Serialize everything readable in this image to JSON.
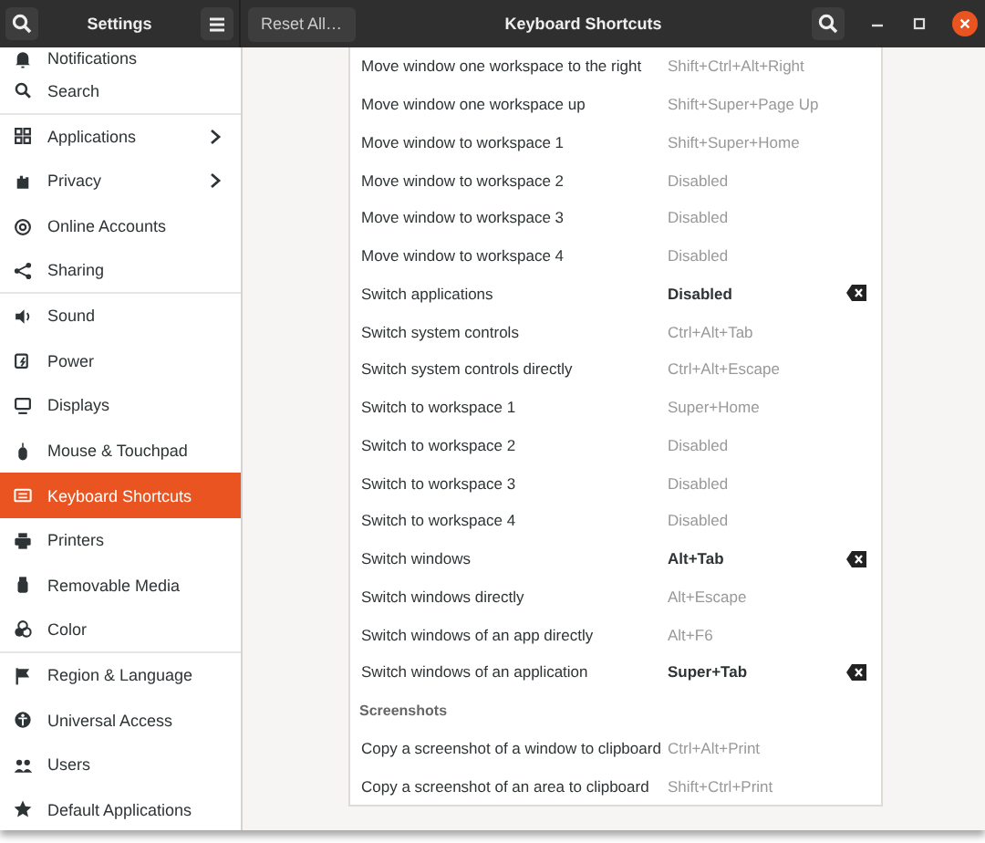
{
  "header": {
    "left_title": "Settings",
    "reset_button": "Reset All…",
    "title": "Keyboard Shortcuts"
  },
  "sidebar": {
    "items": [
      {
        "label": "Notifications",
        "selected": false,
        "arrow": false,
        "separator_after": false
      },
      {
        "label": "Search",
        "selected": false,
        "arrow": false,
        "separator_after": true
      },
      {
        "label": "Applications",
        "selected": false,
        "arrow": true,
        "separator_after": false
      },
      {
        "label": "Privacy",
        "selected": false,
        "arrow": true,
        "separator_after": false
      },
      {
        "label": "Online Accounts",
        "selected": false,
        "arrow": false,
        "separator_after": false
      },
      {
        "label": "Sharing",
        "selected": false,
        "arrow": false,
        "separator_after": true
      },
      {
        "label": "Sound",
        "selected": false,
        "arrow": false,
        "separator_after": false
      },
      {
        "label": "Power",
        "selected": false,
        "arrow": false,
        "separator_after": false
      },
      {
        "label": "Displays",
        "selected": false,
        "arrow": false,
        "separator_after": false
      },
      {
        "label": "Mouse & Touchpad",
        "selected": false,
        "arrow": false,
        "separator_after": false
      },
      {
        "label": "Keyboard Shortcuts",
        "selected": true,
        "arrow": false,
        "separator_after": false
      },
      {
        "label": "Printers",
        "selected": false,
        "arrow": false,
        "separator_after": false
      },
      {
        "label": "Removable Media",
        "selected": false,
        "arrow": false,
        "separator_after": false
      },
      {
        "label": "Color",
        "selected": false,
        "arrow": false,
        "separator_after": true
      },
      {
        "label": "Region & Language",
        "selected": false,
        "arrow": false,
        "separator_after": false
      },
      {
        "label": "Universal Access",
        "selected": false,
        "arrow": false,
        "separator_after": false
      },
      {
        "label": "Users",
        "selected": false,
        "arrow": false,
        "separator_after": false
      },
      {
        "label": "Default Applications",
        "selected": false,
        "arrow": false,
        "separator_after": false
      }
    ]
  },
  "shortcuts": [
    {
      "kind": "row",
      "action": "Move window one workspace to the right",
      "keys": "Shift+Ctrl+Alt+Right",
      "modified": false
    },
    {
      "kind": "row",
      "action": "Move window one workspace up",
      "keys": "Shift+Super+Page Up",
      "modified": false
    },
    {
      "kind": "row",
      "action": "Move window to workspace 1",
      "keys": "Shift+Super+Home",
      "modified": false
    },
    {
      "kind": "row",
      "action": "Move window to workspace 2",
      "keys": "Disabled",
      "modified": false
    },
    {
      "kind": "row",
      "action": "Move window to workspace 3",
      "keys": "Disabled",
      "modified": false
    },
    {
      "kind": "row",
      "action": "Move window to workspace 4",
      "keys": "Disabled",
      "modified": false
    },
    {
      "kind": "row",
      "action": "Switch applications",
      "keys": "Disabled",
      "modified": true
    },
    {
      "kind": "row",
      "action": "Switch system controls",
      "keys": "Ctrl+Alt+Tab",
      "modified": false
    },
    {
      "kind": "row",
      "action": "Switch system controls directly",
      "keys": "Ctrl+Alt+Escape",
      "modified": false
    },
    {
      "kind": "row",
      "action": "Switch to workspace 1",
      "keys": "Super+Home",
      "modified": false
    },
    {
      "kind": "row",
      "action": "Switch to workspace 2",
      "keys": "Disabled",
      "modified": false
    },
    {
      "kind": "row",
      "action": "Switch to workspace 3",
      "keys": "Disabled",
      "modified": false
    },
    {
      "kind": "row",
      "action": "Switch to workspace 4",
      "keys": "Disabled",
      "modified": false
    },
    {
      "kind": "row",
      "action": "Switch windows",
      "keys": "Alt+Tab",
      "modified": true
    },
    {
      "kind": "row",
      "action": "Switch windows directly",
      "keys": "Alt+Escape",
      "modified": false
    },
    {
      "kind": "row",
      "action": "Switch windows of an app directly",
      "keys": "Alt+F6",
      "modified": false
    },
    {
      "kind": "row",
      "action": "Switch windows of an application",
      "keys": "Super+Tab",
      "modified": true
    },
    {
      "kind": "heading",
      "action": "Screenshots"
    },
    {
      "kind": "row",
      "action": "Copy a screenshot of a window to clipboard",
      "keys": "Ctrl+Alt+Print",
      "modified": false
    },
    {
      "kind": "row",
      "action": "Copy a screenshot of an area to clipboard",
      "keys": "Shift+Ctrl+Print",
      "modified": false
    }
  ]
}
